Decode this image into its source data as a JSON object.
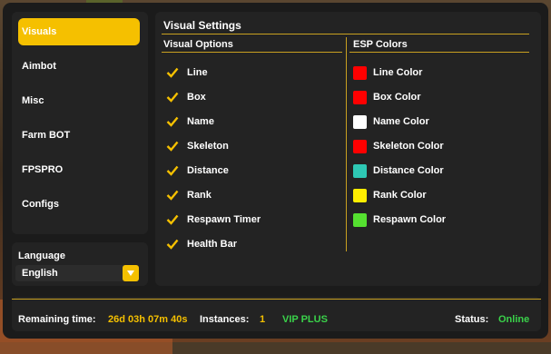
{
  "sidebar": {
    "items": [
      {
        "label": "Visuals",
        "active": true
      },
      {
        "label": "Aimbot",
        "active": false
      },
      {
        "label": "Misc",
        "active": false
      },
      {
        "label": "Farm BOT",
        "active": false
      },
      {
        "label": "FPSPRO",
        "active": false
      },
      {
        "label": "Configs",
        "active": false
      }
    ]
  },
  "language": {
    "label": "Language",
    "selected": "English"
  },
  "main": {
    "title": "Visual Settings",
    "options_header": "Visual Options",
    "colors_header": "ESP Colors",
    "options": [
      {
        "label": "Line",
        "checked": true
      },
      {
        "label": "Box",
        "checked": true
      },
      {
        "label": "Name",
        "checked": true
      },
      {
        "label": "Skeleton",
        "checked": true
      },
      {
        "label": "Distance",
        "checked": true
      },
      {
        "label": "Rank",
        "checked": true
      },
      {
        "label": "Respawn Timer",
        "checked": true
      },
      {
        "label": "Health Bar",
        "checked": true
      }
    ],
    "colors": [
      {
        "label": "Line Color",
        "color": "#ff0000"
      },
      {
        "label": "Box Color",
        "color": "#ff0000"
      },
      {
        "label": "Name Color",
        "color": "#ffffff"
      },
      {
        "label": "Skeleton Color",
        "color": "#ff0000"
      },
      {
        "label": "Distance Color",
        "color": "#2ec8b4"
      },
      {
        "label": "Rank Color",
        "color": "#ffee00"
      },
      {
        "label": "Respawn Color",
        "color": "#55e030"
      }
    ]
  },
  "footer": {
    "remaining_label": "Remaining time:",
    "remaining_value": "26d 03h 07m 40s",
    "instances_label": "Instances:",
    "instances_value": "1",
    "plan": "VIP PLUS",
    "status_label": "Status:",
    "status_value": "Online"
  },
  "theme": {
    "accent": "#f5c000",
    "panel": "#232323",
    "window": "#1b1b1b",
    "success": "#3ad24a"
  }
}
